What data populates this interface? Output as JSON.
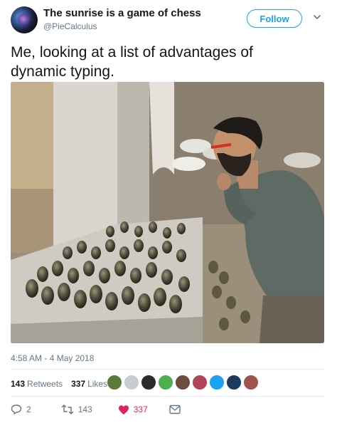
{
  "author": {
    "display_name": "The sunrise is a game of chess",
    "handle": "@PieCalculus",
    "avatar_icon": "nebula-avatar"
  },
  "follow_label": "Follow",
  "tweet": {
    "text": "Me, looking at a list of advantages of dynamic typing."
  },
  "photo": {
    "alt_icon": "photo-man-examining-grenades"
  },
  "timestamp": "4:58 AM - 4 May 2018",
  "stats": {
    "retweets_count": "143",
    "retweets_label": "Retweets",
    "likes_count": "337",
    "likes_label": "Likes"
  },
  "likers": [
    {
      "color": "#5a7a3a"
    },
    {
      "color": "#c7ccd1"
    },
    {
      "color": "#2b2b2b"
    },
    {
      "color": "#4caf50"
    },
    {
      "color": "#6d4c41"
    },
    {
      "color": "#b2455a"
    },
    {
      "color": "#1da1f2"
    },
    {
      "color": "#1b3a5c"
    },
    {
      "color": "#a0524d"
    }
  ],
  "actions": {
    "reply_count": "2",
    "retweet_count": "143",
    "like_count": "337"
  },
  "colors": {
    "accent": "#1da1f2",
    "like": "#e0245e",
    "muted": "#657786"
  }
}
